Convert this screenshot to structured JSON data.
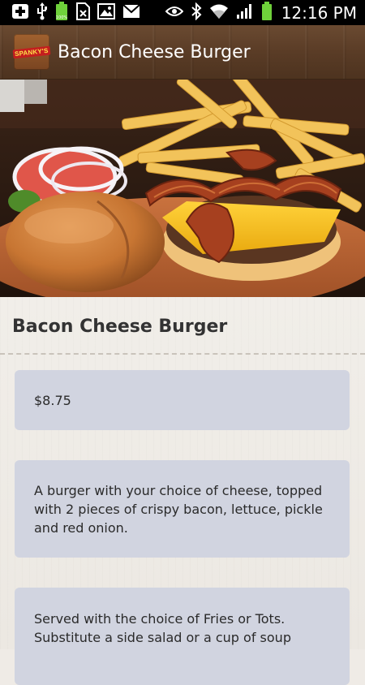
{
  "status_bar": {
    "time": "12:16 PM",
    "icons": [
      "add-icon",
      "usb-icon",
      "battery-full-icon",
      "no-sim-icon",
      "image-icon",
      "mail-icon",
      "eye-icon",
      "bluetooth-icon",
      "wifi-icon",
      "signal-icon",
      "battery-icon"
    ]
  },
  "action_bar": {
    "logo_text": "SPANKY'S",
    "title": "Bacon Cheese Burger"
  },
  "item": {
    "title": "Bacon Cheese Burger",
    "price": "$8.75",
    "description": "A burger with your choice of cheese, topped with 2 pieces of crispy bacon, lettuce, pickle and red onion.",
    "sides": "Served with the choice of Fries or Tots. Substitute a side salad or a cup of soup"
  },
  "colors": {
    "action_bar": "#5a3c26",
    "card": "#d1d4e0",
    "background": "#efebe6"
  }
}
